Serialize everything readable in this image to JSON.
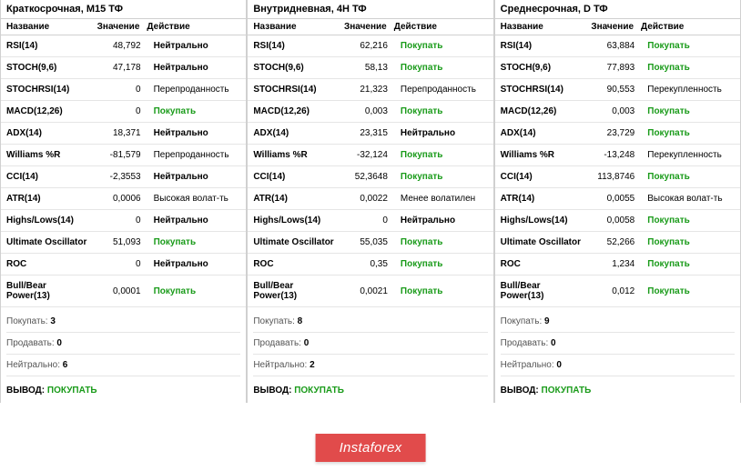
{
  "headers": {
    "name": "Название",
    "value": "Значение",
    "action": "Действие"
  },
  "panels": [
    {
      "title": "Краткосрочная, M15 ТФ",
      "rows": [
        {
          "name": "RSI(14)",
          "value": "48,792",
          "action": "Нейтрально",
          "cls": "bold"
        },
        {
          "name": "STOCH(9,6)",
          "value": "47,178",
          "action": "Нейтрально",
          "cls": "bold"
        },
        {
          "name": "STOCHRSI(14)",
          "value": "0",
          "action": "Перепроданность",
          "cls": ""
        },
        {
          "name": "MACD(12,26)",
          "value": "0",
          "action": "Покупать",
          "cls": "buy"
        },
        {
          "name": "ADX(14)",
          "value": "18,371",
          "action": "Нейтрально",
          "cls": "bold"
        },
        {
          "name": "Williams %R",
          "value": "-81,579",
          "action": "Перепроданность",
          "cls": ""
        },
        {
          "name": "CCI(14)",
          "value": "-2,3553",
          "action": "Нейтрально",
          "cls": "bold"
        },
        {
          "name": "ATR(14)",
          "value": "0,0006",
          "action": "Высокая волат-ть",
          "cls": ""
        },
        {
          "name": "Highs/Lows(14)",
          "value": "0",
          "action": "Нейтрально",
          "cls": "bold"
        },
        {
          "name": "Ultimate Oscillator",
          "value": "51,093",
          "action": "Покупать",
          "cls": "buy"
        },
        {
          "name": "ROC",
          "value": "0",
          "action": "Нейтрально",
          "cls": "bold"
        },
        {
          "name": "Bull/Bear Power(13)",
          "value": "0,0001",
          "action": "Покупать",
          "cls": "buy"
        }
      ],
      "summary": {
        "buy": "3",
        "sell": "0",
        "neutral": "6"
      },
      "conclusion": "ПОКУПАТЬ"
    },
    {
      "title": "Внутридневная, 4H ТФ",
      "rows": [
        {
          "name": "RSI(14)",
          "value": "62,216",
          "action": "Покупать",
          "cls": "buy"
        },
        {
          "name": "STOCH(9,6)",
          "value": "58,13",
          "action": "Покупать",
          "cls": "buy"
        },
        {
          "name": "STOCHRSI(14)",
          "value": "21,323",
          "action": "Перепроданность",
          "cls": ""
        },
        {
          "name": "MACD(12,26)",
          "value": "0,003",
          "action": "Покупать",
          "cls": "buy"
        },
        {
          "name": "ADX(14)",
          "value": "23,315",
          "action": "Нейтрально",
          "cls": "bold"
        },
        {
          "name": "Williams %R",
          "value": "-32,124",
          "action": "Покупать",
          "cls": "buy"
        },
        {
          "name": "CCI(14)",
          "value": "52,3648",
          "action": "Покупать",
          "cls": "buy"
        },
        {
          "name": "ATR(14)",
          "value": "0,0022",
          "action": "Менее волатилен",
          "cls": ""
        },
        {
          "name": "Highs/Lows(14)",
          "value": "0",
          "action": "Нейтрально",
          "cls": "bold"
        },
        {
          "name": "Ultimate Oscillator",
          "value": "55,035",
          "action": "Покупать",
          "cls": "buy"
        },
        {
          "name": "ROC",
          "value": "0,35",
          "action": "Покупать",
          "cls": "buy"
        },
        {
          "name": "Bull/Bear Power(13)",
          "value": "0,0021",
          "action": "Покупать",
          "cls": "buy"
        }
      ],
      "summary": {
        "buy": "8",
        "sell": "0",
        "neutral": "2"
      },
      "conclusion": "ПОКУПАТЬ"
    },
    {
      "title": "Среднесрочная, D ТФ",
      "rows": [
        {
          "name": "RSI(14)",
          "value": "63,884",
          "action": "Покупать",
          "cls": "buy"
        },
        {
          "name": "STOCH(9,6)",
          "value": "77,893",
          "action": "Покупать",
          "cls": "buy"
        },
        {
          "name": "STOCHRSI(14)",
          "value": "90,553",
          "action": "Перекупленность",
          "cls": ""
        },
        {
          "name": "MACD(12,26)",
          "value": "0,003",
          "action": "Покупать",
          "cls": "buy"
        },
        {
          "name": "ADX(14)",
          "value": "23,729",
          "action": "Покупать",
          "cls": "buy"
        },
        {
          "name": "Williams %R",
          "value": "-13,248",
          "action": "Перекупленность",
          "cls": ""
        },
        {
          "name": "CCI(14)",
          "value": "113,8746",
          "action": "Покупать",
          "cls": "buy"
        },
        {
          "name": "ATR(14)",
          "value": "0,0055",
          "action": "Высокая волат-ть",
          "cls": ""
        },
        {
          "name": "Highs/Lows(14)",
          "value": "0,0058",
          "action": "Покупать",
          "cls": "buy"
        },
        {
          "name": "Ultimate Oscillator",
          "value": "52,266",
          "action": "Покупать",
          "cls": "buy"
        },
        {
          "name": "ROC",
          "value": "1,234",
          "action": "Покупать",
          "cls": "buy"
        },
        {
          "name": "Bull/Bear Power(13)",
          "value": "0,012",
          "action": "Покупать",
          "cls": "buy"
        }
      ],
      "summary": {
        "buy": "9",
        "sell": "0",
        "neutral": "0"
      },
      "conclusion": "ПОКУПАТЬ"
    }
  ],
  "labels": {
    "buy": "Покупать:",
    "sell": "Продавать:",
    "neutral": "Нейтрально:",
    "conclusion": "ВЫВОД:"
  },
  "brand": "Instaforex"
}
